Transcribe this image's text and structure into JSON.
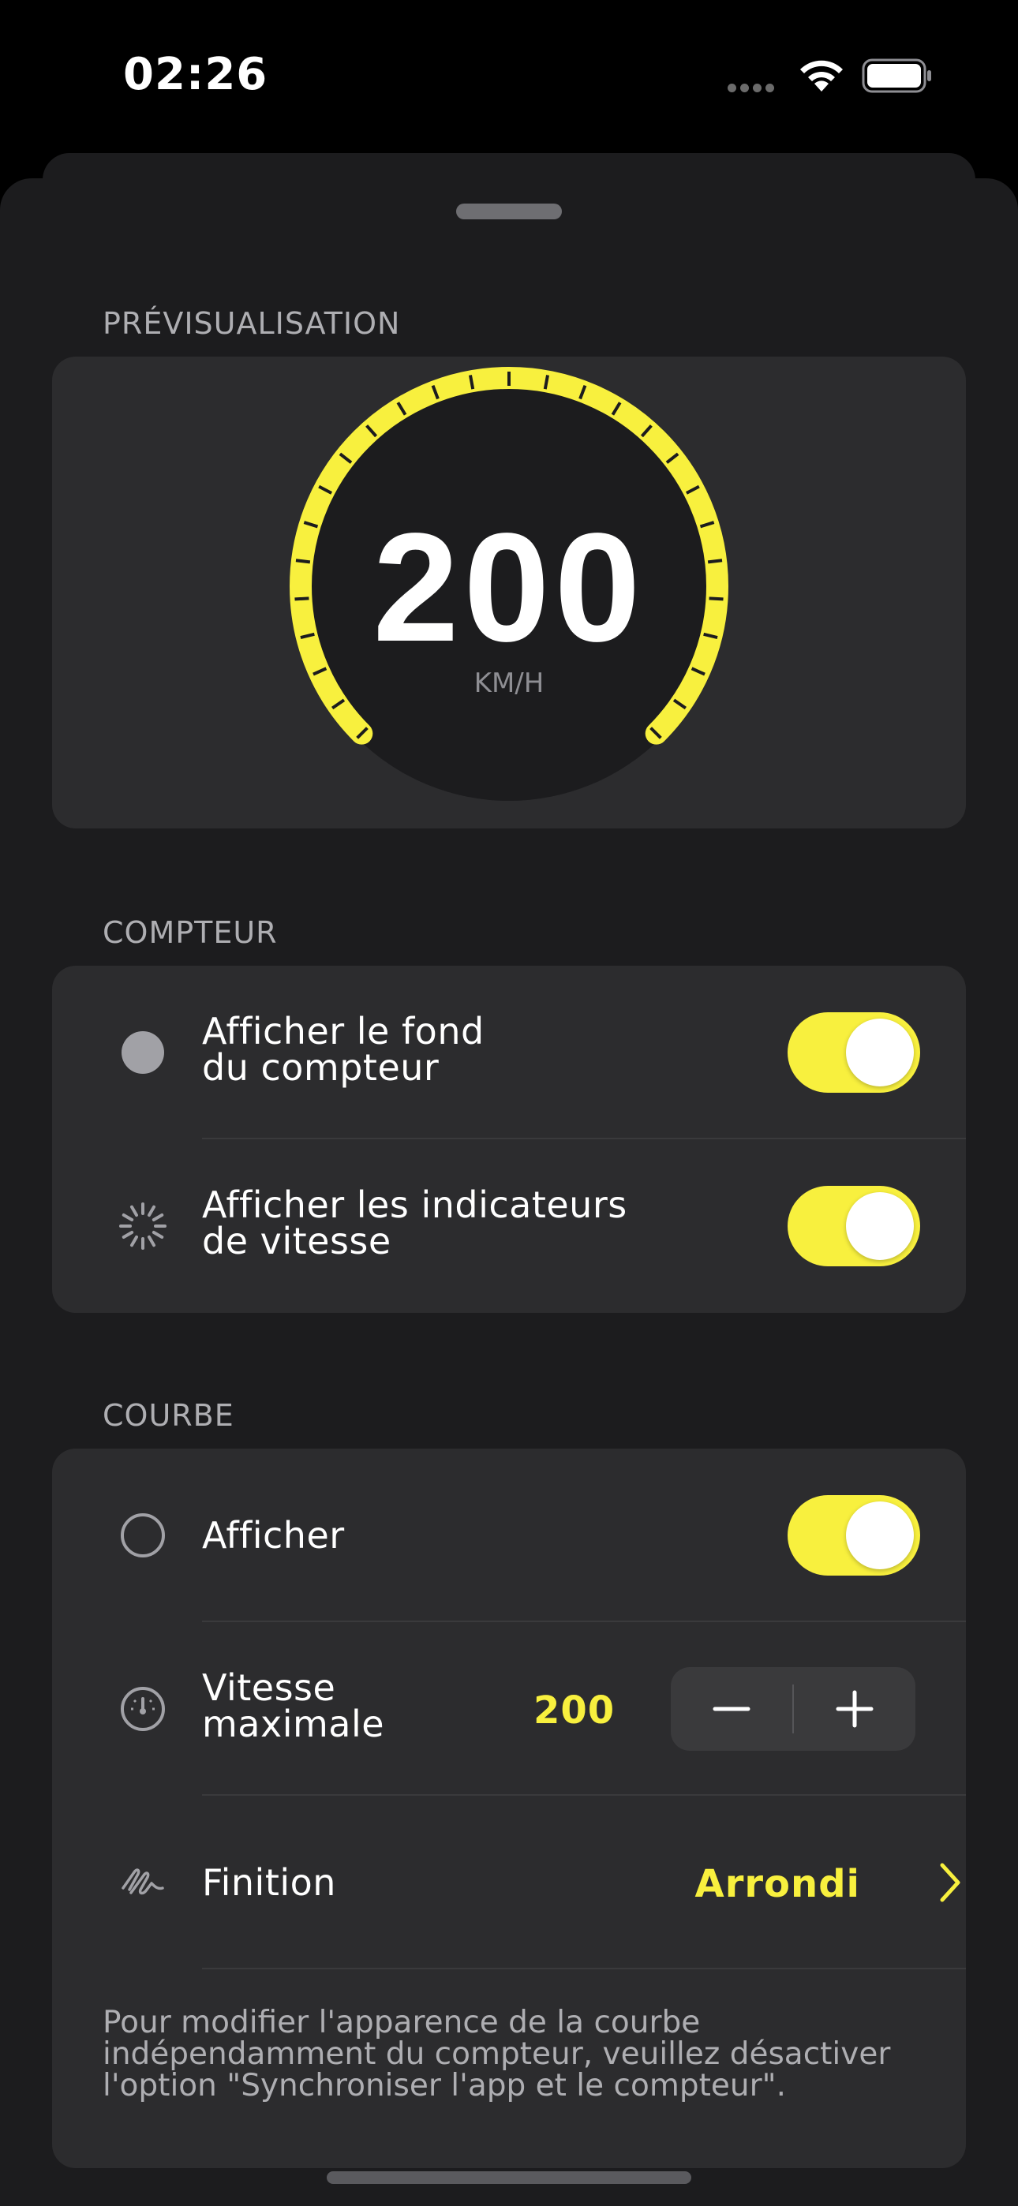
{
  "status_bar": {
    "time": "02:26",
    "icons": [
      "signal-dots-icon",
      "wifi-icon",
      "battery-icon"
    ]
  },
  "preview": {
    "section_title": "PRÉVISUALISATION",
    "speed_value": "200",
    "unit": "KM/H",
    "accent_color": "#f8f03e"
  },
  "counter": {
    "section_title": "COMPTEUR",
    "rows": [
      {
        "label_line1": "Afficher le fond",
        "label_line2": "du compteur",
        "icon": "filled-circle-icon",
        "toggle_on": true
      },
      {
        "label_line1": "Afficher les indicateurs",
        "label_line2": "de vitesse",
        "icon": "tick-marks-icon",
        "toggle_on": true
      }
    ]
  },
  "curve": {
    "section_title": "COURBE",
    "show_label": "Afficher",
    "show_icon": "circle-outline-icon",
    "show_toggle_on": true,
    "max_speed_label_line1": "Vitesse",
    "max_speed_label_line2": "maximale",
    "max_speed_icon": "speedometer-icon",
    "max_speed_value": "200",
    "stepper_minus": "−",
    "stepper_plus": "+",
    "finish_label": "Finition",
    "finish_icon": "scribble-icon",
    "finish_value": "Arrondi",
    "footer_note": "Pour modifier l'apparence de la courbe indépendamment du compteur, veuillez désactiver l'option \"Synchroniser l'app et le compteur\"."
  }
}
